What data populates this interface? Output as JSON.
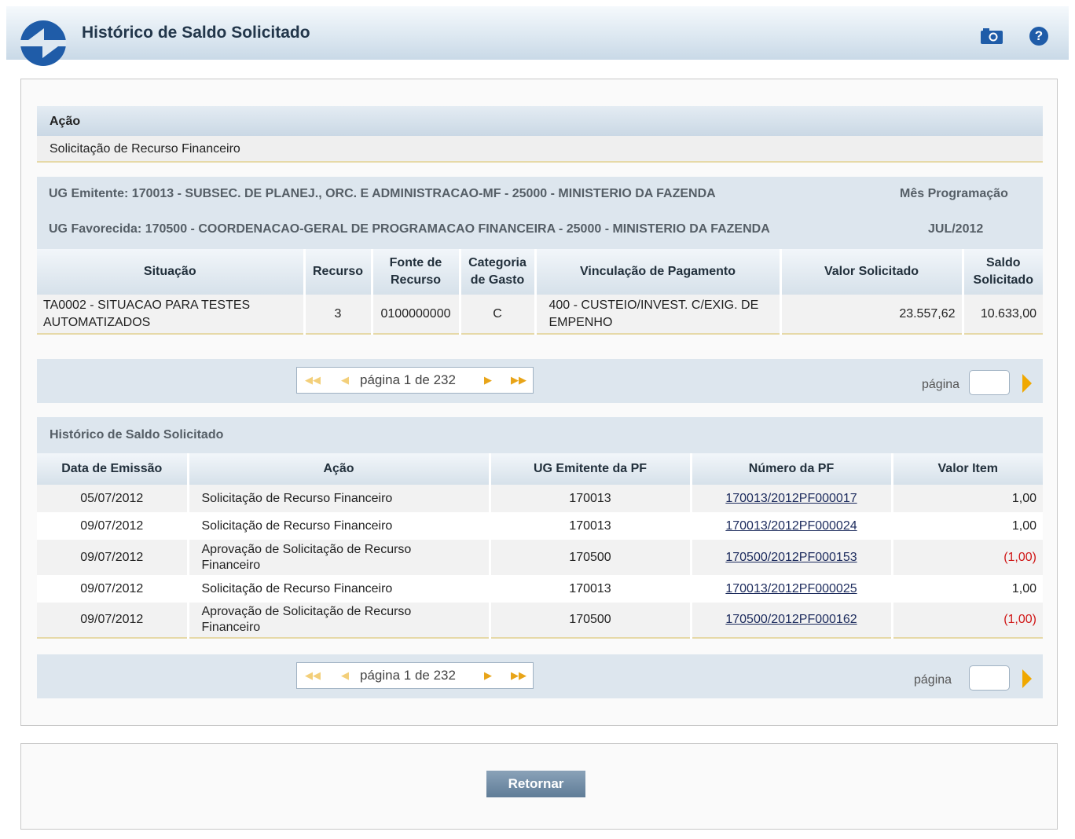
{
  "header": {
    "title": "Histórico de Saldo Solicitado",
    "icons": [
      "logo-icon",
      "camera-icon",
      "help-icon"
    ],
    "help_glyph": "?"
  },
  "acao": {
    "label": "Ação",
    "value": "Solicitação de Recurso Financeiro"
  },
  "ug": {
    "emitente": "UG Emitente: 170013 - SUBSEC. DE PLANEJ., ORC. E ADMINISTRACAO-MF - 25000 - MINISTERIO DA FAZENDA",
    "favorecida": "UG Favorecida: 170500 - COORDENACAO-GERAL DE PROGRAMACAO FINANCEIRA - 25000 - MINISTERIO DA FAZENDA",
    "mes_label": "Mês Programação",
    "mes_value": "JUL/2012"
  },
  "summary_table": {
    "headers": [
      "Situação",
      "Recurso",
      "Fonte de Recurso",
      "Categoria de Gasto",
      "Vinculação de Pagamento",
      "Valor Solicitado",
      "Saldo Solicitado"
    ],
    "row": [
      "TA0002 - SITUACAO PARA TESTES AUTOMATIZADOS",
      "3",
      "0100000000",
      "C",
      "400 - CUSTEIO/INVEST. C/EXIG. DE EMPENHO",
      "23.557,62",
      "10.633,00"
    ]
  },
  "pager": {
    "text": "página 1 de 232",
    "label": "página"
  },
  "history": {
    "title": "Histórico de Saldo Solicitado",
    "headers": [
      "Data de Emissão",
      "Ação",
      "UG Emitente da PF",
      "Número da PF",
      "Valor Item"
    ],
    "rows": [
      [
        "05/07/2012",
        "Solicitação de Recurso Financeiro",
        "170013",
        "170013/2012PF000017",
        "1,00"
      ],
      [
        "09/07/2012",
        "Solicitação de Recurso Financeiro",
        "170013",
        "170013/2012PF000024",
        "1,00"
      ],
      [
        "09/07/2012",
        "Aprovação de Solicitação de Recurso Financeiro",
        "170500",
        "170500/2012PF000153",
        "(1,00)"
      ],
      [
        "09/07/2012",
        "Solicitação de Recurso Financeiro",
        "170013",
        "170013/2012PF000025",
        "1,00"
      ],
      [
        "09/07/2012",
        "Aprovação de Solicitação de Recurso Financeiro",
        "170500",
        "170500/2012PF000162",
        "(1,00)"
      ]
    ]
  },
  "footer": {
    "return_label": "Retornar"
  },
  "colors": {
    "accent": "#1f5ca8",
    "negative": "#d01818",
    "pager_arrow": "#f0a800"
  }
}
